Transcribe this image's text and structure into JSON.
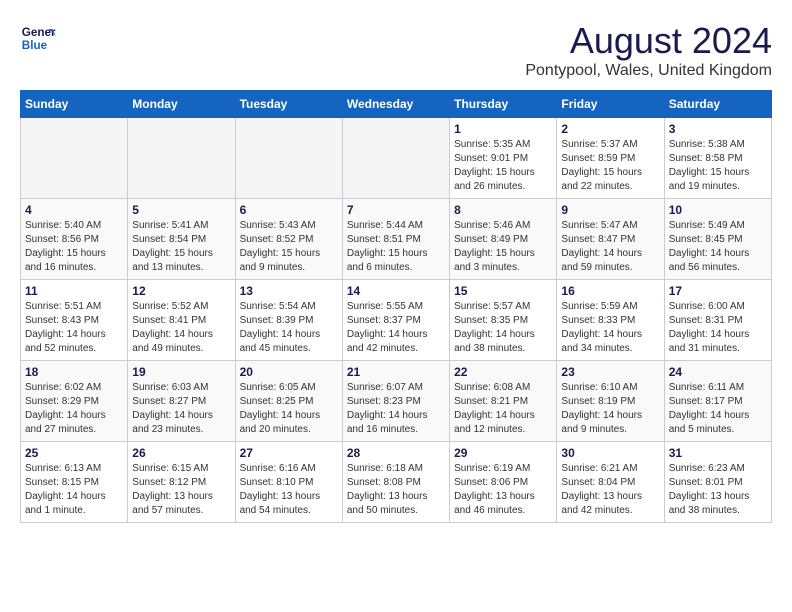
{
  "logo": {
    "line1": "General",
    "line2": "Blue"
  },
  "title": "August 2024",
  "location": "Pontypool, Wales, United Kingdom",
  "weekdays": [
    "Sunday",
    "Monday",
    "Tuesday",
    "Wednesday",
    "Thursday",
    "Friday",
    "Saturday"
  ],
  "weeks": [
    [
      {
        "day": "",
        "info": ""
      },
      {
        "day": "",
        "info": ""
      },
      {
        "day": "",
        "info": ""
      },
      {
        "day": "",
        "info": ""
      },
      {
        "day": "1",
        "info": "Sunrise: 5:35 AM\nSunset: 9:01 PM\nDaylight: 15 hours\nand 26 minutes."
      },
      {
        "day": "2",
        "info": "Sunrise: 5:37 AM\nSunset: 8:59 PM\nDaylight: 15 hours\nand 22 minutes."
      },
      {
        "day": "3",
        "info": "Sunrise: 5:38 AM\nSunset: 8:58 PM\nDaylight: 15 hours\nand 19 minutes."
      }
    ],
    [
      {
        "day": "4",
        "info": "Sunrise: 5:40 AM\nSunset: 8:56 PM\nDaylight: 15 hours\nand 16 minutes."
      },
      {
        "day": "5",
        "info": "Sunrise: 5:41 AM\nSunset: 8:54 PM\nDaylight: 15 hours\nand 13 minutes."
      },
      {
        "day": "6",
        "info": "Sunrise: 5:43 AM\nSunset: 8:52 PM\nDaylight: 15 hours\nand 9 minutes."
      },
      {
        "day": "7",
        "info": "Sunrise: 5:44 AM\nSunset: 8:51 PM\nDaylight: 15 hours\nand 6 minutes."
      },
      {
        "day": "8",
        "info": "Sunrise: 5:46 AM\nSunset: 8:49 PM\nDaylight: 15 hours\nand 3 minutes."
      },
      {
        "day": "9",
        "info": "Sunrise: 5:47 AM\nSunset: 8:47 PM\nDaylight: 14 hours\nand 59 minutes."
      },
      {
        "day": "10",
        "info": "Sunrise: 5:49 AM\nSunset: 8:45 PM\nDaylight: 14 hours\nand 56 minutes."
      }
    ],
    [
      {
        "day": "11",
        "info": "Sunrise: 5:51 AM\nSunset: 8:43 PM\nDaylight: 14 hours\nand 52 minutes."
      },
      {
        "day": "12",
        "info": "Sunrise: 5:52 AM\nSunset: 8:41 PM\nDaylight: 14 hours\nand 49 minutes."
      },
      {
        "day": "13",
        "info": "Sunrise: 5:54 AM\nSunset: 8:39 PM\nDaylight: 14 hours\nand 45 minutes."
      },
      {
        "day": "14",
        "info": "Sunrise: 5:55 AM\nSunset: 8:37 PM\nDaylight: 14 hours\nand 42 minutes."
      },
      {
        "day": "15",
        "info": "Sunrise: 5:57 AM\nSunset: 8:35 PM\nDaylight: 14 hours\nand 38 minutes."
      },
      {
        "day": "16",
        "info": "Sunrise: 5:59 AM\nSunset: 8:33 PM\nDaylight: 14 hours\nand 34 minutes."
      },
      {
        "day": "17",
        "info": "Sunrise: 6:00 AM\nSunset: 8:31 PM\nDaylight: 14 hours\nand 31 minutes."
      }
    ],
    [
      {
        "day": "18",
        "info": "Sunrise: 6:02 AM\nSunset: 8:29 PM\nDaylight: 14 hours\nand 27 minutes."
      },
      {
        "day": "19",
        "info": "Sunrise: 6:03 AM\nSunset: 8:27 PM\nDaylight: 14 hours\nand 23 minutes."
      },
      {
        "day": "20",
        "info": "Sunrise: 6:05 AM\nSunset: 8:25 PM\nDaylight: 14 hours\nand 20 minutes."
      },
      {
        "day": "21",
        "info": "Sunrise: 6:07 AM\nSunset: 8:23 PM\nDaylight: 14 hours\nand 16 minutes."
      },
      {
        "day": "22",
        "info": "Sunrise: 6:08 AM\nSunset: 8:21 PM\nDaylight: 14 hours\nand 12 minutes."
      },
      {
        "day": "23",
        "info": "Sunrise: 6:10 AM\nSunset: 8:19 PM\nDaylight: 14 hours\nand 9 minutes."
      },
      {
        "day": "24",
        "info": "Sunrise: 6:11 AM\nSunset: 8:17 PM\nDaylight: 14 hours\nand 5 minutes."
      }
    ],
    [
      {
        "day": "25",
        "info": "Sunrise: 6:13 AM\nSunset: 8:15 PM\nDaylight: 14 hours\nand 1 minute."
      },
      {
        "day": "26",
        "info": "Sunrise: 6:15 AM\nSunset: 8:12 PM\nDaylight: 13 hours\nand 57 minutes."
      },
      {
        "day": "27",
        "info": "Sunrise: 6:16 AM\nSunset: 8:10 PM\nDaylight: 13 hours\nand 54 minutes."
      },
      {
        "day": "28",
        "info": "Sunrise: 6:18 AM\nSunset: 8:08 PM\nDaylight: 13 hours\nand 50 minutes."
      },
      {
        "day": "29",
        "info": "Sunrise: 6:19 AM\nSunset: 8:06 PM\nDaylight: 13 hours\nand 46 minutes."
      },
      {
        "day": "30",
        "info": "Sunrise: 6:21 AM\nSunset: 8:04 PM\nDaylight: 13 hours\nand 42 minutes."
      },
      {
        "day": "31",
        "info": "Sunrise: 6:23 AM\nSunset: 8:01 PM\nDaylight: 13 hours\nand 38 minutes."
      }
    ]
  ]
}
